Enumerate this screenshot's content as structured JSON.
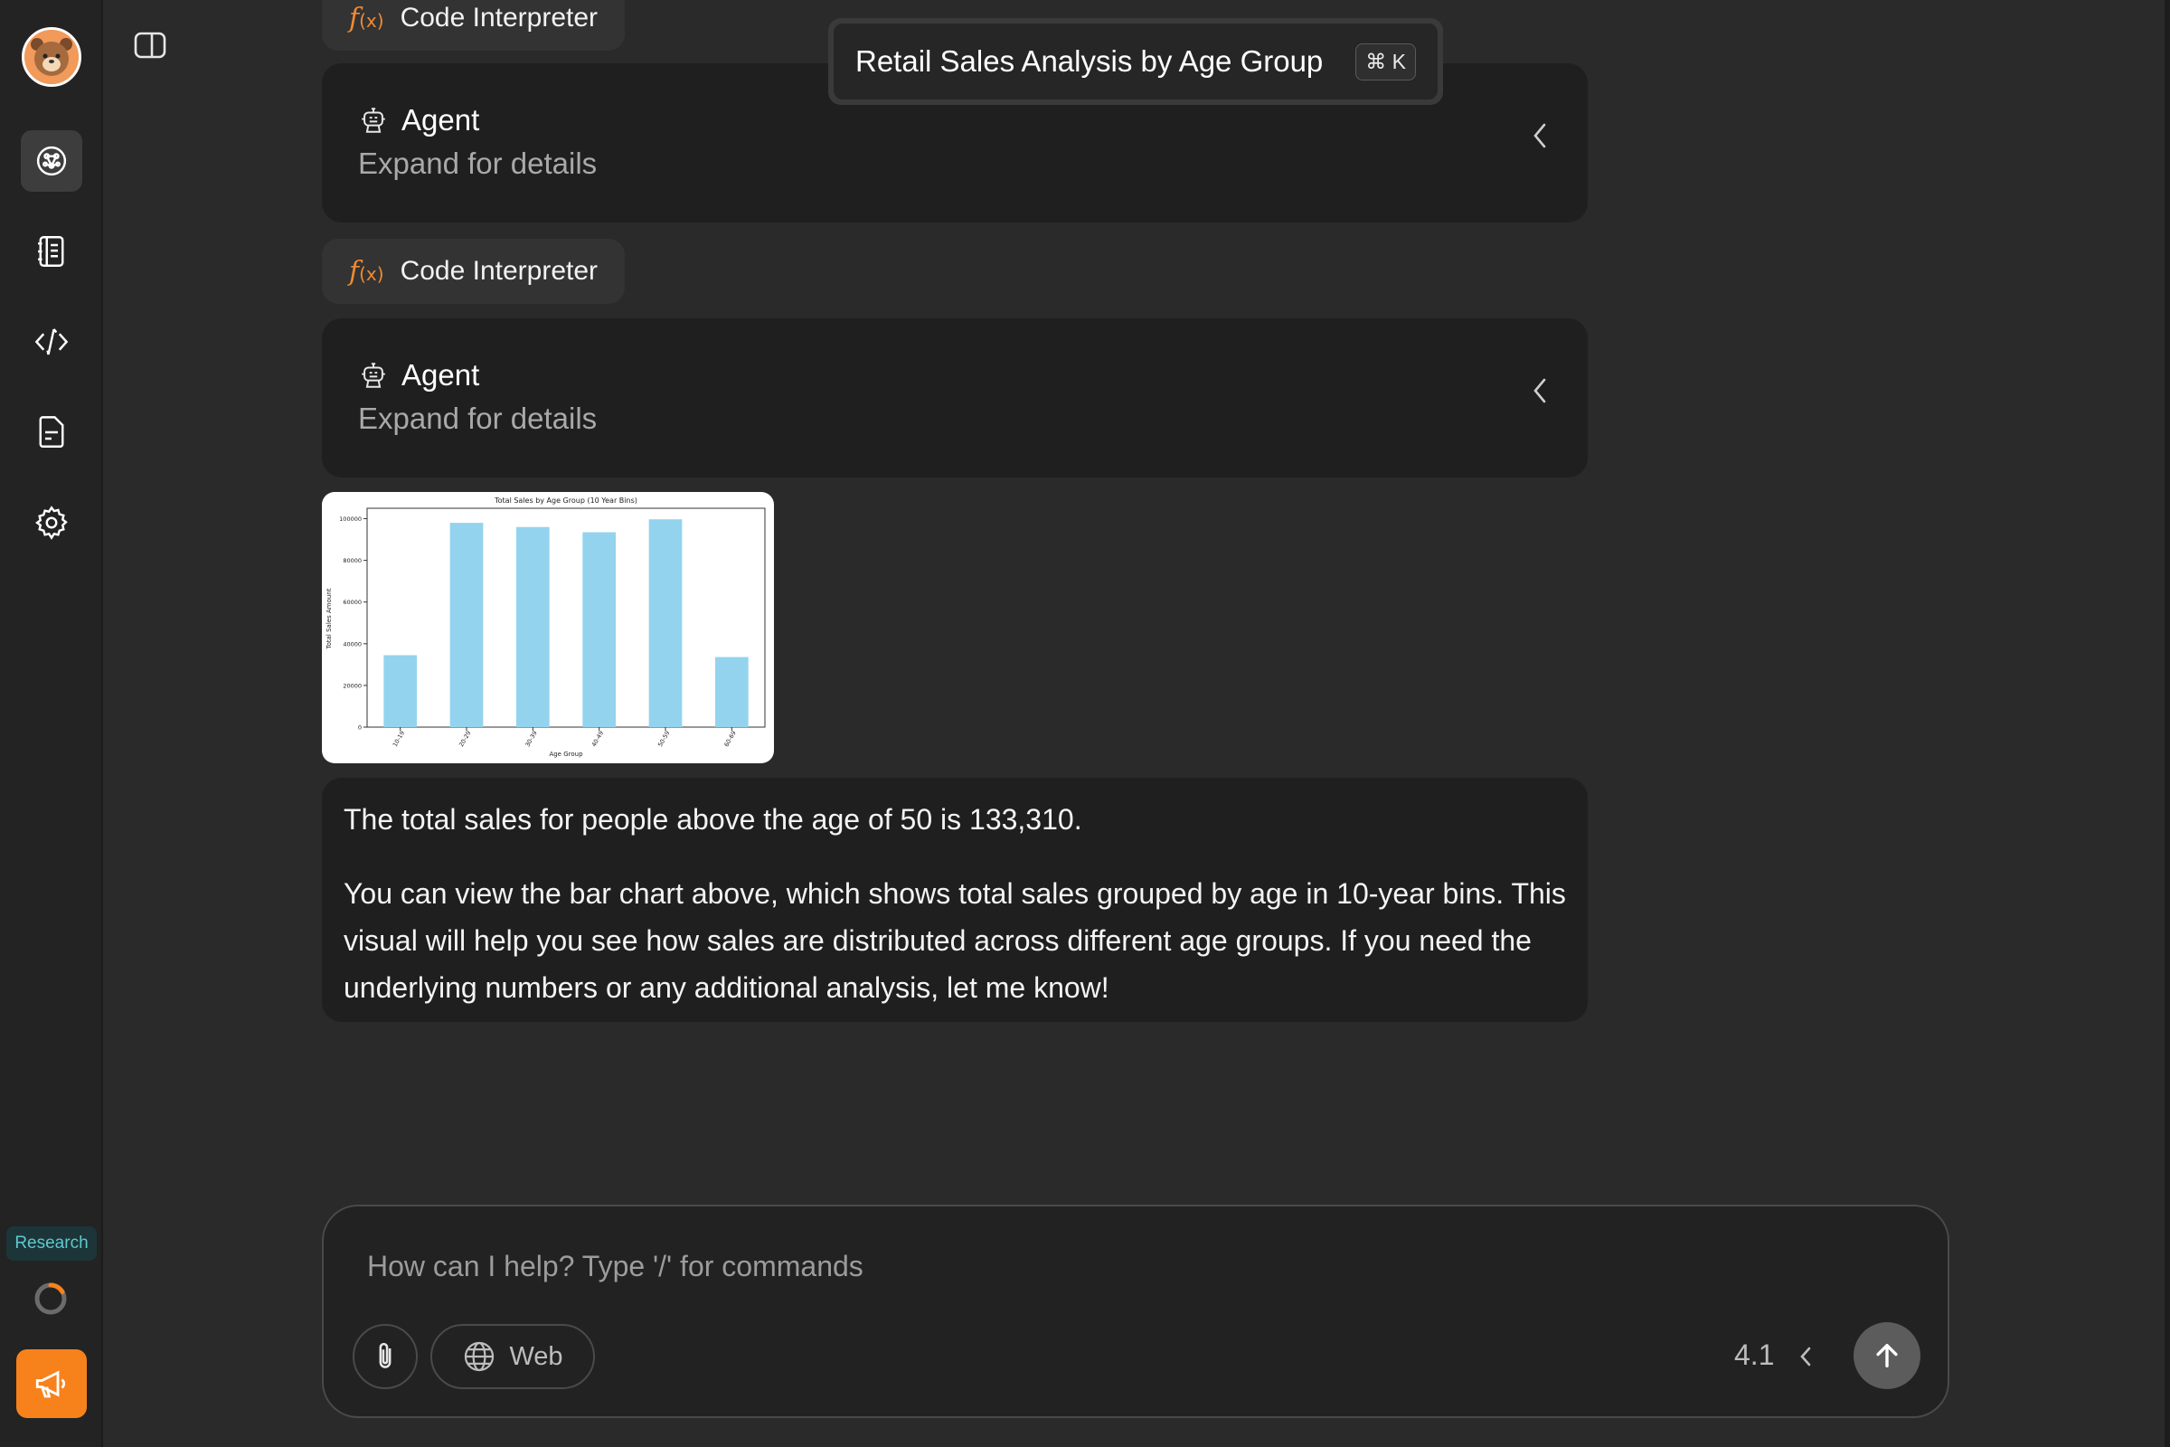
{
  "sidebar": {
    "research_badge": "Research"
  },
  "title_bar": {
    "title": "Retail Sales Analysis by Age Group",
    "shortcut": "⌘ K"
  },
  "messages": {
    "tool_1": {
      "icon_text": "f",
      "label": "Code Interpreter"
    },
    "agent_1": {
      "title": "Agent",
      "subtitle": "Expand for details"
    },
    "tool_2": {
      "icon_text": "f",
      "label": "Code Interpreter"
    },
    "agent_2": {
      "title": "Agent",
      "subtitle": "Expand for details"
    },
    "answer": {
      "line_1": "The total sales for people above the age of 50 is 133,310.",
      "line_2": "You can view the bar chart above, which shows total sales grouped by age in 10-year bins. This visual will help you see how sales are distributed across different age groups. If you need the underlying numbers or any additional analysis, let me know!"
    }
  },
  "chart_data": {
    "type": "bar",
    "title": "Total Sales by Age Group (10 Year Bins)",
    "xlabel": "Age Group",
    "ylabel": "Total Sales Amount",
    "categories": [
      "10-19",
      "20-29",
      "30-39",
      "40-49",
      "50-59",
      "60-69"
    ],
    "values": [
      34500,
      98000,
      96000,
      93500,
      99700,
      33600
    ],
    "ylim": [
      0,
      105000
    ],
    "yticks": [
      0,
      20000,
      40000,
      60000,
      80000,
      100000
    ],
    "color": "#93d3ee",
    "grid": false
  },
  "composer": {
    "placeholder": "How can I help? Type '/' for commands",
    "web_label": "Web",
    "model_version": "4.1"
  },
  "colors": {
    "accent": "#f7821c",
    "background": "#2a2a2a",
    "card": "#1f1f1f"
  }
}
